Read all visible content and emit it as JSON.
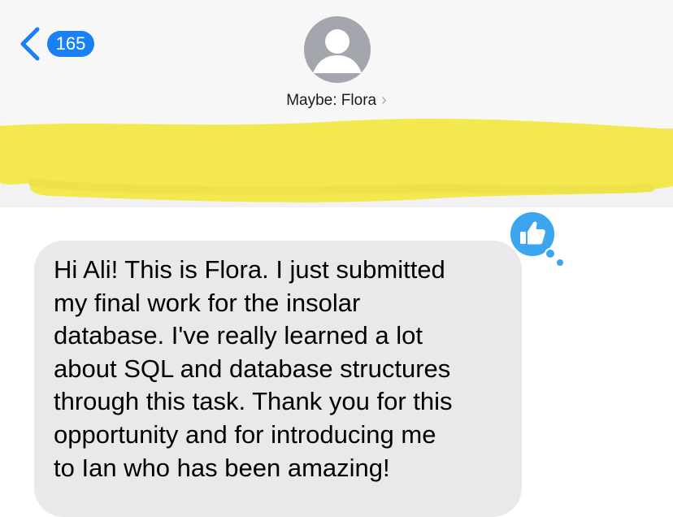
{
  "header": {
    "back_badge_count": "165",
    "contact_name": "Maybe: Flora",
    "contact_chevron": "›"
  },
  "icons": {
    "back": "chevron-left-icon",
    "avatar": "person-icon",
    "tapback": "thumbs-up-icon"
  },
  "colors": {
    "accent_blue": "#1a80f5",
    "bubble_gray": "#e9e9eb",
    "tapback_blue": "#3aa6ef",
    "redaction_yellow": "#f3e94e",
    "avatar_gray": "#a3a6ad"
  },
  "message": {
    "sender": "received",
    "text": "Hi Ali! This is Flora. I just submitted\nmy final work for the insolar\ndatabase. I've really learned a lot\nabout SQL and database structures\nthrough this task. Thank you for this\nopportunity and for introducing me\nto Ian who has been amazing!",
    "tapback": "thumbs-up"
  }
}
